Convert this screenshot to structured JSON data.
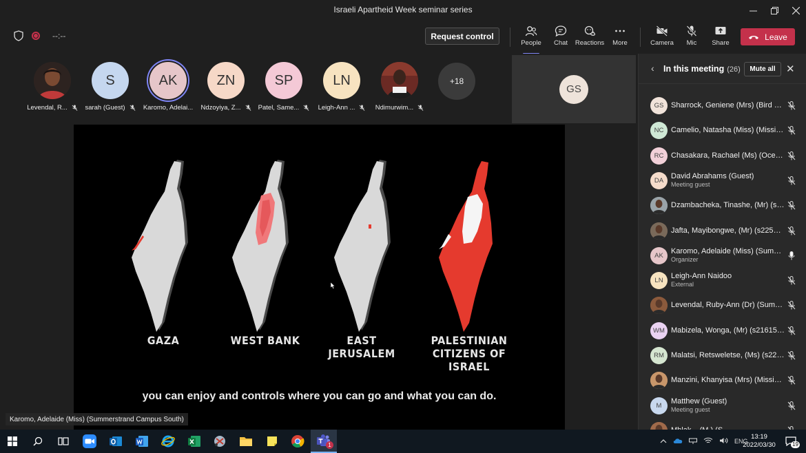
{
  "window": {
    "title": "Israeli Apartheid Week seminar series"
  },
  "toolbar": {
    "timer": "--:--",
    "request_control": "Request control",
    "people": "People",
    "chat": "Chat",
    "reactions": "Reactions",
    "more": "More",
    "camera": "Camera",
    "mic": "Mic",
    "share": "Share",
    "leave": "Leave"
  },
  "strip": {
    "participants": [
      {
        "initials": "",
        "name": "Levendal, R...",
        "color": "#8b5a3c",
        "photo": true
      },
      {
        "initials": "S",
        "name": "sarah (Guest)",
        "color": "#c5d7ef"
      },
      {
        "initials": "AK",
        "name": "Karomo, Adelai...",
        "color": "#e6c6c9",
        "speaking": true
      },
      {
        "initials": "ZN",
        "name": "Ndzoyiya, Z...",
        "color": "#f6d8c7"
      },
      {
        "initials": "SP",
        "name": "Patel, Same...",
        "color": "#f4c9d6"
      },
      {
        "initials": "LN",
        "name": "Leigh-Ann ...",
        "color": "#f7e3c0"
      },
      {
        "initials": "",
        "name": "Ndimurwim...",
        "color": "#5a3b30",
        "photo": true
      }
    ],
    "overflow": "+18",
    "tile_initials": "GS"
  },
  "slide": {
    "maps": [
      {
        "label": "GAZA"
      },
      {
        "label": "WEST BANK"
      },
      {
        "label": "EAST\nJERUSALEM"
      },
      {
        "label": "PALESTINIAN\nCITIZENS OF\nISRAEL"
      }
    ],
    "subtitle": "you can enjoy and controls where you can go and what you can do.",
    "speaker": "Karomo, Adelaide (Miss) (Summerstrand Campus South)"
  },
  "panel": {
    "title": "In this meeting",
    "count": "(26)",
    "mute_all": "Mute all",
    "people": [
      {
        "initials": "GS",
        "name": "Sharrock, Geniene (Mrs) (Bird Str...",
        "role": "",
        "color": "#f1e3da",
        "mic": "muted"
      },
      {
        "initials": "NC",
        "name": "Camelio, Natasha (Miss) (Missio...",
        "role": "",
        "color": "#cfe8d5",
        "mic": "muted"
      },
      {
        "initials": "RC",
        "name": "Chasakara, Rachael (Ms) (Ocean ...",
        "role": "",
        "color": "#f2d0d8",
        "mic": "muted"
      },
      {
        "initials": "DA",
        "name": "David Abrahams (Guest)",
        "role": "Meeting guest",
        "color": "#f5dccb",
        "mic": "muted"
      },
      {
        "initials": "",
        "name": "Dzambacheka, Tinashe, (Mr) (s2...",
        "role": "",
        "color": "#9aa3a8",
        "mic": "muted",
        "photo": true
      },
      {
        "initials": "",
        "name": "Jafta, Mayibongwe, (Mr) (s22528...",
        "role": "",
        "color": "#7a6a5a",
        "mic": "muted",
        "photo": true
      },
      {
        "initials": "AK",
        "name": "Karomo, Adelaide (Miss) (Summ...",
        "role": "Organizer",
        "color": "#e6c6c9",
        "mic": "on"
      },
      {
        "initials": "LN",
        "name": "Leigh-Ann Naidoo",
        "role": "External",
        "color": "#f7e3c0",
        "mic": "muted"
      },
      {
        "initials": "",
        "name": "Levendal, Ruby-Ann (Dr) (Summ...",
        "role": "",
        "color": "#8b5a3c",
        "mic": "muted",
        "photo": true
      },
      {
        "initials": "WM",
        "name": "Mabizela, Wonga, (Mr) (s216154...",
        "role": "",
        "color": "#ead2f2",
        "mic": "muted"
      },
      {
        "initials": "RM",
        "name": "Malatsi, Retsweletse, (Ms) (s220...",
        "role": "",
        "color": "#d5e6d0",
        "mic": "muted"
      },
      {
        "initials": "",
        "name": "Manzini, Khanyisa (Mrs) (Missio...",
        "role": "",
        "color": "#c8966a",
        "mic": "muted",
        "photo": true
      },
      {
        "initials": "M",
        "name": "Matthew (Guest)",
        "role": "Meeting guest",
        "color": "#c8d8ee",
        "mic": "muted"
      },
      {
        "initials": "",
        "name": "Mhlak... (M.) (S...",
        "role": "",
        "color": "#a06a4a",
        "mic": "muted",
        "photo": true
      }
    ]
  },
  "taskbar": {
    "lang": "ENG",
    "time": "13:19",
    "date": "2022/03/30",
    "notifications": "19",
    "teams_badge": "1"
  }
}
